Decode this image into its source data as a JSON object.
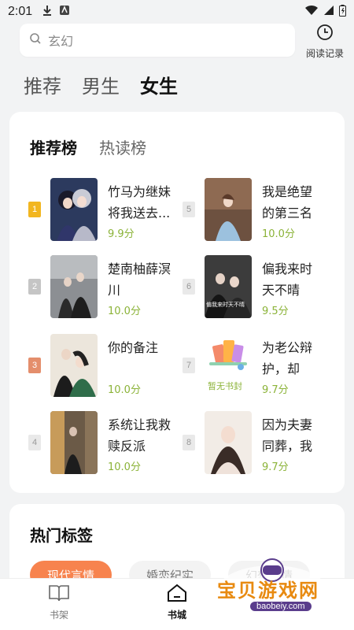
{
  "status_bar": {
    "time": "2:01"
  },
  "search": {
    "placeholder": "玄幻"
  },
  "history": {
    "label": "阅读记录"
  },
  "channel_tabs": [
    {
      "label": "推荐",
      "active": false
    },
    {
      "label": "男生",
      "active": false
    },
    {
      "label": "女生",
      "active": true
    }
  ],
  "ranking": {
    "tabs": [
      {
        "label": "推荐榜",
        "active": true
      },
      {
        "label": "热读榜",
        "active": false
      }
    ],
    "items": [
      {
        "rank": "1",
        "title": "竹马为继妹将我送去...",
        "score": "9.9分",
        "badge_color": "#f2b620"
      },
      {
        "rank": "2",
        "title": "楚南柚薛溟川",
        "score": "10.0分",
        "badge_color": "#c5c5c5"
      },
      {
        "rank": "3",
        "title": "你的备注",
        "score": "10.0分",
        "badge_color": "#e48e6c"
      },
      {
        "rank": "4",
        "title": "系统让我救赎反派",
        "score": "10.0分",
        "badge_color": "#e9e9e9"
      },
      {
        "rank": "5",
        "title": "我是绝望的第三名",
        "score": "10.0分",
        "badge_color": "#e9e9e9"
      },
      {
        "rank": "6",
        "title": "偏我来时天不晴",
        "score": "9.5分",
        "badge_color": "#e9e9e9"
      },
      {
        "rank": "7",
        "title": "为老公辩护，却在...",
        "score": "9.7分",
        "badge_color": "#e9e9e9"
      },
      {
        "rank": "8",
        "title": "因为夫妻同葬，我跟...",
        "score": "9.7分",
        "badge_color": "#e9e9e9"
      }
    ],
    "no_cover_text": "暂无书封",
    "cover_text_6": "偏我来时天不晴"
  },
  "hot_tags": {
    "title": "热门标签",
    "tags": [
      "现代言情",
      "婚恋纪实",
      "幻想言情"
    ]
  },
  "bottom_nav": [
    {
      "label": "书架",
      "active": false
    },
    {
      "label": "书城",
      "active": true
    }
  ],
  "watermark": {
    "text": "宝贝游戏网",
    "url": "baobeiy.com"
  },
  "colors": {
    "score": "#8bb338",
    "accent_tag": "#f7834e"
  }
}
